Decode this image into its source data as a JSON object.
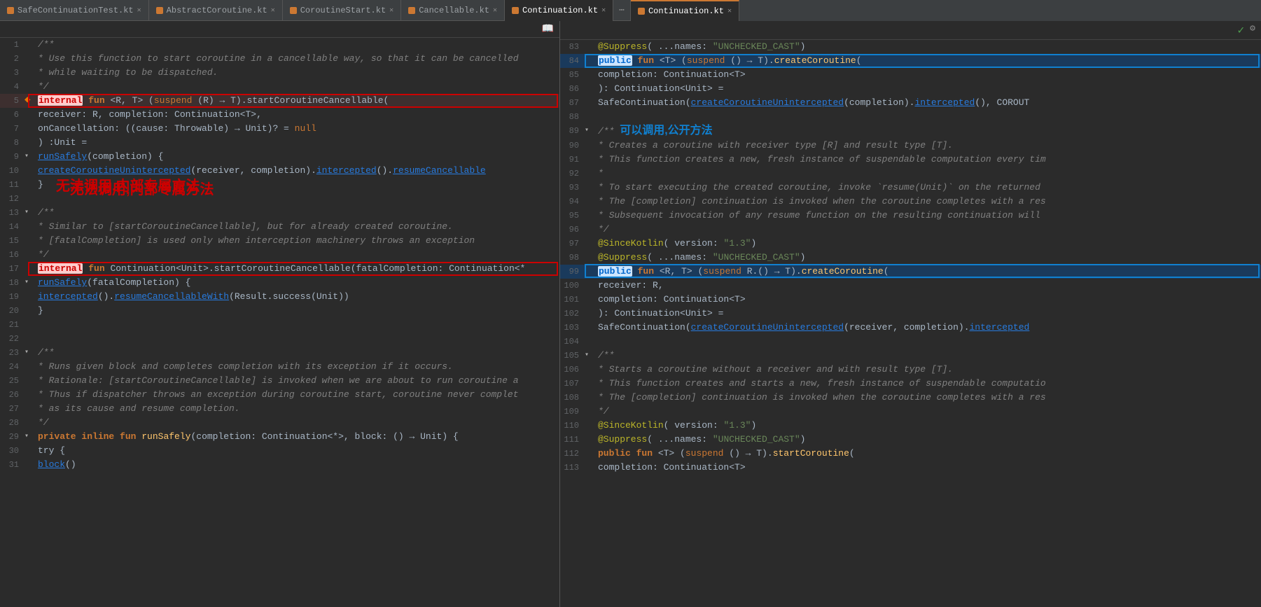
{
  "tabs": [
    {
      "label": "SafeContinuationTest.kt",
      "active": false,
      "color": "#cc7832"
    },
    {
      "label": "AbstractCoroutine.kt",
      "active": false,
      "color": "#cc7832"
    },
    {
      "label": "CoroutineStart.kt",
      "active": false,
      "color": "#cc7832"
    },
    {
      "label": "Cancellable.kt",
      "active": false,
      "color": "#cc7832"
    },
    {
      "label": "Continuation.kt",
      "active": true,
      "color": "#cc7832"
    },
    {
      "label": "Continuation.kt",
      "active": true,
      "color": "#cc7832"
    }
  ],
  "left_lines": [
    {
      "num": "1",
      "content": "/**",
      "type": "comment"
    },
    {
      "num": "2",
      "content": " * Use this function to start coroutine in a cancellable way, so that it can be cancelled",
      "type": "comment"
    },
    {
      "num": "3",
      "content": " * while waiting to be dispatched.",
      "type": "comment"
    },
    {
      "num": "4",
      "content": " */",
      "type": "comment"
    },
    {
      "num": "5",
      "content": "internal fun <R, T> (suspend (R) → T).startCoroutineCancellable(",
      "type": "code",
      "highlight": true
    },
    {
      "num": "6",
      "content": "    receiver: R, completion: Continuation<T>,",
      "type": "code"
    },
    {
      "num": "7",
      "content": "    onCancellation: ((cause: Throwable) → Unit)? = null",
      "type": "code"
    },
    {
      "num": "8",
      "content": ") :Unit =",
      "type": "code"
    },
    {
      "num": "9",
      "content": "    runSafely(completion) {",
      "type": "code"
    },
    {
      "num": "10",
      "content": "        createCoroutineUnintercepted(receiver, completion).intercepted().resumeCancellable",
      "type": "code"
    },
    {
      "num": "11",
      "content": "    }",
      "type": "code"
    },
    {
      "num": "12",
      "content": "",
      "type": "empty"
    },
    {
      "num": "13",
      "content": "/**",
      "type": "comment"
    },
    {
      "num": "14",
      "content": " * Similar to [startCoroutineCancellable], but for already created coroutine.",
      "type": "comment"
    },
    {
      "num": "15",
      "content": " * [fatalCompletion] is used only when interception machinery throws an exception",
      "type": "comment"
    },
    {
      "num": "16",
      "content": " */",
      "type": "comment"
    },
    {
      "num": "17",
      "content": "internal fun Continuation<Unit>.startCoroutineCancellable(fatalCompletion: Continuation<*",
      "type": "code",
      "highlight2": true
    },
    {
      "num": "18",
      "content": "    runSafely(fatalCompletion) {",
      "type": "code"
    },
    {
      "num": "19",
      "content": "        intercepted().resumeCancellableWith(Result.success(Unit))",
      "type": "code"
    },
    {
      "num": "20",
      "content": "    }",
      "type": "code"
    },
    {
      "num": "21",
      "content": "",
      "type": "empty"
    },
    {
      "num": "22",
      "content": "",
      "type": "empty"
    },
    {
      "num": "23",
      "content": "/**",
      "type": "comment"
    },
    {
      "num": "24",
      "content": " * Runs given block and completes completion with its exception if it occurs.",
      "type": "comment"
    },
    {
      "num": "25",
      "content": " * Rationale: [startCoroutineCancellable] is invoked when we are about to run coroutine a",
      "type": "comment"
    },
    {
      "num": "26",
      "content": " * Thus if dispatcher throws an exception during coroutine start, coroutine never complet",
      "type": "comment"
    },
    {
      "num": "27",
      "content": " * as its cause and resume completion.",
      "type": "comment"
    },
    {
      "num": "28",
      "content": " */",
      "type": "comment"
    },
    {
      "num": "29",
      "content": "private inline fun runSafely(completion: Continuation<*>, block: () → Unit) {",
      "type": "code"
    },
    {
      "num": "30",
      "content": "    try {",
      "type": "code"
    },
    {
      "num": "31",
      "content": "        block()",
      "type": "code"
    }
  ],
  "right_lines": [
    {
      "num": "83",
      "content": "    @Suppress( ...names: \"UNCHECKED_CAST\")",
      "type": "annotation"
    },
    {
      "num": "84",
      "content": "    public fun <T> (suspend () → T).createCoroutine(",
      "type": "code",
      "box": true
    },
    {
      "num": "85",
      "content": "        completion: Continuation<T>",
      "type": "code"
    },
    {
      "num": "86",
      "content": "    ): Continuation<Unit> =",
      "type": "code"
    },
    {
      "num": "87",
      "content": "        SafeContinuation(createCoroutineUnintercepted(completion).intercepted(), COROUT",
      "type": "code"
    },
    {
      "num": "88",
      "content": "",
      "type": "empty"
    },
    {
      "num": "89",
      "content": "/**    可以调用,公开方法",
      "type": "comment_cn"
    },
    {
      "num": "90",
      "content": " * Creates a coroutine with receiver type [R] and result type [T].",
      "type": "comment"
    },
    {
      "num": "91",
      "content": " * This function creates a new, fresh instance of suspendable computation every tim",
      "type": "comment"
    },
    {
      "num": "92",
      "content": " *",
      "type": "comment"
    },
    {
      "num": "93",
      "content": " * To start executing the created coroutine, invoke `resume(Unit)` on the returned",
      "type": "comment"
    },
    {
      "num": "94",
      "content": " * The [completion] continuation is invoked when the coroutine completes with a res",
      "type": "comment"
    },
    {
      "num": "95",
      "content": " * Subsequent invocation of any resume function on the resulting continuation will",
      "type": "comment"
    },
    {
      "num": "96",
      "content": " */",
      "type": "comment"
    },
    {
      "num": "97",
      "content": "    @SinceKotlin( version: \"1.3\")",
      "type": "annotation"
    },
    {
      "num": "98",
      "content": "    @Suppress( ...names: \"UNCHECKED_CAST\")",
      "type": "annotation"
    },
    {
      "num": "99",
      "content": "    public fun <R, T> (suspend R.() → T).createCoroutine(",
      "type": "code",
      "box": true
    },
    {
      "num": "100",
      "content": "        receiver: R,",
      "type": "code"
    },
    {
      "num": "101",
      "content": "        completion: Continuation<T>",
      "type": "code"
    },
    {
      "num": "102",
      "content": "    ): Continuation<Unit> =",
      "type": "code"
    },
    {
      "num": "103",
      "content": "        SafeContinuation(createCoroutineUnintercepted(receiver, completion).intercepted",
      "type": "code"
    },
    {
      "num": "104",
      "content": "",
      "type": "empty"
    },
    {
      "num": "105",
      "content": "/**",
      "type": "comment"
    },
    {
      "num": "106",
      "content": " * Starts a coroutine without a receiver and with result type [T].",
      "type": "comment"
    },
    {
      "num": "107",
      "content": " * This function creates and starts a new, fresh instance of suspendable computatio",
      "type": "comment"
    },
    {
      "num": "108",
      "content": " * The [completion] continuation is invoked when the coroutine completes with a res",
      "type": "comment"
    },
    {
      "num": "109",
      "content": " */",
      "type": "comment"
    },
    {
      "num": "110",
      "content": "    @SinceKotlin( version: \"1.3\")",
      "type": "annotation"
    },
    {
      "num": "111",
      "content": "    @Suppress( ...names: \"UNCHECKED_CAST\")",
      "type": "annotation"
    },
    {
      "num": "112",
      "content": "    public fun <T> (suspend () → T).startCoroutine(",
      "type": "code"
    },
    {
      "num": "113",
      "content": "        completion: Continuation<T>",
      "type": "code"
    }
  ],
  "annotation_no_call": "无法调用,内部专属方法",
  "annotation_can_call": "可以调用,公开方法"
}
